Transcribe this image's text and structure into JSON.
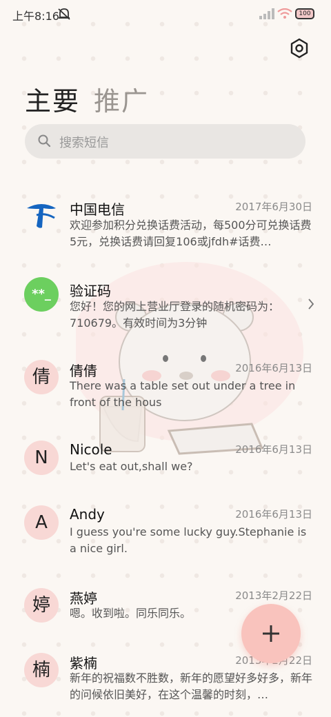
{
  "status_bar": {
    "time": "上午8:16",
    "battery": "100"
  },
  "tabs": {
    "primary": "主要",
    "promotions": "推广"
  },
  "search": {
    "placeholder": "搜索短信"
  },
  "conversations": [
    {
      "name": "中国电信",
      "date": "2017年6月30日",
      "preview": "欢迎参加积分兑换话费活动，每500分可兑换话费5元，兑换话费请回复106或jfdh#话费…",
      "avatar_icon": "china-telecom-logo-icon"
    },
    {
      "name": "验证码",
      "date": "",
      "preview": "您好！您的网上营业厅登录的随机密码为：710679。有效时间为3分钟",
      "avatar_text": "**_"
    },
    {
      "name": "倩倩",
      "date": "2016年6月13日",
      "preview": "There was a table set out under a tree in front of the hous",
      "avatar_text": "倩"
    },
    {
      "name": "Nicole",
      "date": "2016年6月13日",
      "preview": "Let's eat out,shall we?",
      "avatar_text": "N"
    },
    {
      "name": "Andy",
      "date": "2016年6月13日",
      "preview": "I guess you're some lucky guy.Stephanie is a nice girl.",
      "avatar_text": "A"
    },
    {
      "name": "燕婷",
      "date": "2013年2月22日",
      "preview": "嗯。收到啦。同乐同乐。",
      "avatar_text": "婷"
    },
    {
      "name": "紫楠",
      "date": "2013年2月22日",
      "preview": "新年的祝福数不胜数，新年的愿望好多好多，新年的问候依旧美好，在这个温馨的时刻，…",
      "avatar_text": "楠"
    }
  ],
  "colors": {
    "accent": "#f9c3bd",
    "avatar_bg": "#f8d8d5",
    "verify_green": "#6ccf5f",
    "telecom_blue": "#1565c0"
  }
}
